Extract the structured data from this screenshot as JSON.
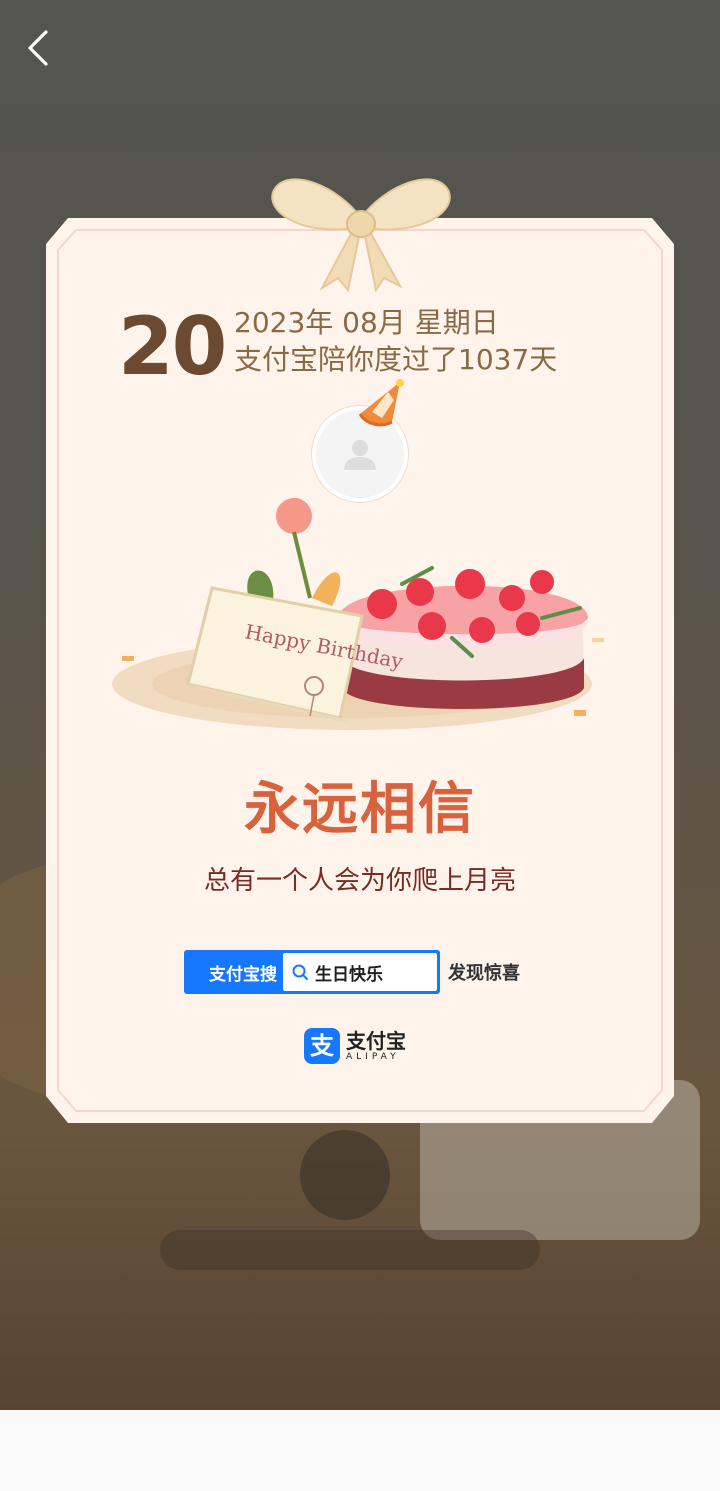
{
  "nav": {
    "back_label": ""
  },
  "card": {
    "day": "20",
    "date_line": "2023年 08月 星期日",
    "companion_line": "支付宝陪你度过了1037天",
    "illustration_text": "Happy Birthday",
    "headline": "永远相信",
    "subline": "总有一个人会为你爬上月亮"
  },
  "search": {
    "label": "支付宝搜",
    "query": "生日快乐",
    "suffix": "发现惊喜"
  },
  "brand": {
    "mark": "支",
    "name_cn": "支付宝",
    "name_en": "ALIPAY"
  },
  "colors": {
    "accent": "#1677ff",
    "headline": "#d8623e",
    "card_bg": "#fff4ec",
    "date_text": "#8a6a45"
  },
  "icons": [
    "chevron-left-icon",
    "bow-icon",
    "party-hat-icon",
    "user-icon",
    "search-icon",
    "alipay-logo-icon"
  ]
}
